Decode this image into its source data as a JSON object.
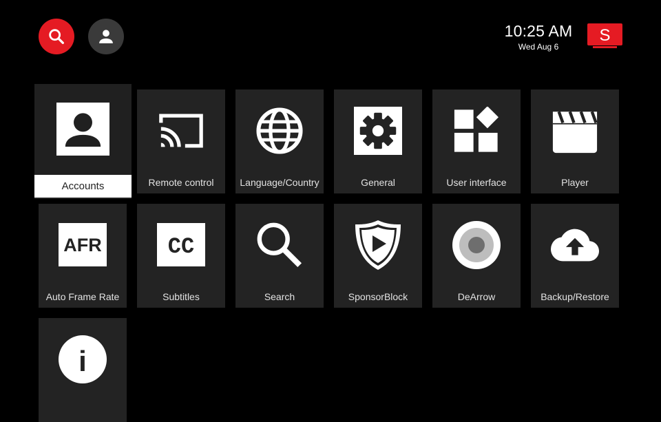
{
  "theme": {
    "background": "#000000",
    "accent": "#e51b23",
    "tile": "#232323",
    "icon": "#ffffff"
  },
  "header": {
    "search_icon": "search-icon",
    "profile_icon": "account-circle-icon",
    "time": "10:25 AM",
    "date": "Wed Aug 6",
    "brand_letter": "S"
  },
  "tiles": [
    {
      "label": "Accounts",
      "icon": "account-icon",
      "focused": true
    },
    {
      "label": "Remote control",
      "icon": "cast-icon"
    },
    {
      "label": "Language/Country",
      "icon": "globe-icon"
    },
    {
      "label": "General",
      "icon": "gear-icon"
    },
    {
      "label": "User interface",
      "icon": "widgets-icon"
    },
    {
      "label": "Player",
      "icon": "clapperboard-icon"
    },
    {
      "label": "Auto Frame Rate",
      "icon": "afr-icon",
      "icon_text": "AFR"
    },
    {
      "label": "Subtitles",
      "icon": "closed-caption-icon",
      "icon_text": "CC"
    },
    {
      "label": "Search",
      "icon": "magnifier-icon"
    },
    {
      "label": "SponsorBlock",
      "icon": "sponsorblock-icon"
    },
    {
      "label": "DeArrow",
      "icon": "dearrow-icon"
    },
    {
      "label": "Backup/Restore",
      "icon": "cloud-upload-icon"
    },
    {
      "label": "",
      "icon": "info-icon",
      "icon_text": "i"
    }
  ]
}
